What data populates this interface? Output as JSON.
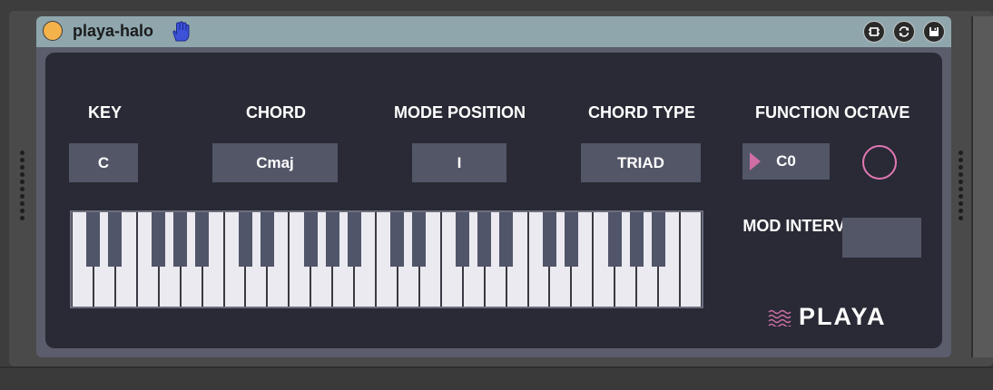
{
  "device": {
    "title": "playa-halo",
    "power_color": "#f4b24a"
  },
  "labels": {
    "key": "KEY",
    "chord": "CHORD",
    "mode_position": "MODE POSITION",
    "chord_type": "CHORD TYPE",
    "function_octave": "FUNCTION OCTAVE",
    "mod_interval": "MOD INTERVAL"
  },
  "values": {
    "key": "C",
    "chord": "Cmaj",
    "mode_position": "I",
    "chord_type": "TRIAD",
    "function_octave": "C0",
    "mod_interval": ""
  },
  "logo": {
    "text": "PLAYA"
  },
  "colors": {
    "accent_pink": "#e277b5",
    "field_bg": "#525667",
    "panel_bg": "#292a35"
  },
  "icons": {
    "hand": "hand-icon",
    "freeze": "freeze-icon",
    "sync": "sync-icon",
    "save": "save-icon"
  }
}
